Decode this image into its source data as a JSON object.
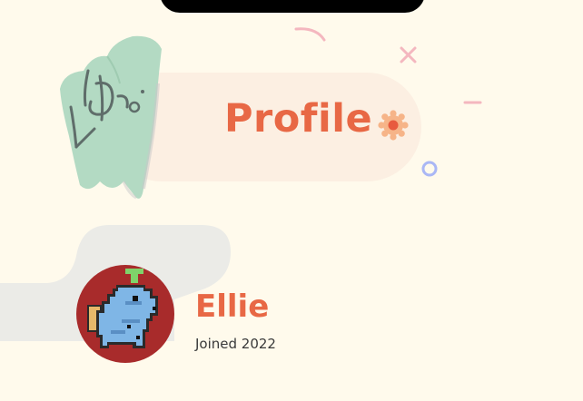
{
  "header": {
    "title": "Profile",
    "settings_icon": "gear-icon",
    "mascot_icon": "hand-mascot-icon"
  },
  "profile": {
    "name": "Ellie",
    "joined": "Joined 2022",
    "avatar_icon": "pixel-dinosaur-avatar"
  },
  "colors": {
    "background": "#fffaec",
    "accent": "#e86845",
    "title_pill": "#fcefe2",
    "mascot": "#b3dac3",
    "avatar_bg": "#a82b2b",
    "blob": "#ebebe7"
  }
}
